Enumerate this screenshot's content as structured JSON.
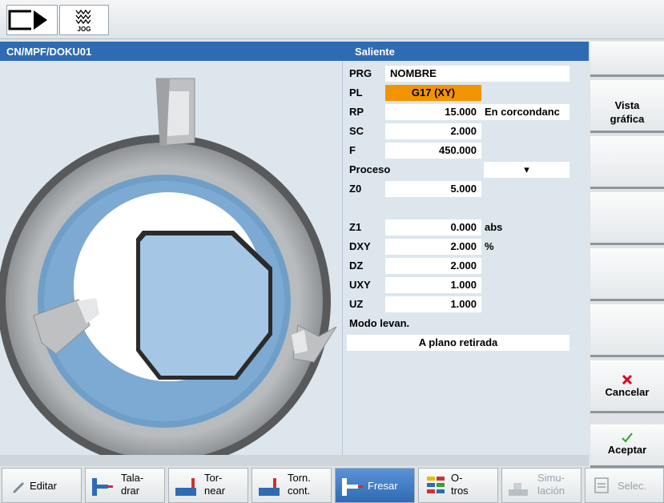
{
  "header": {
    "jog_label": "JOG"
  },
  "title": {
    "path": "CN/MPF/DOKU01",
    "cycle": "Saliente"
  },
  "params": {
    "prg": {
      "label": "PRG",
      "value": "NOMBRE"
    },
    "pl": {
      "label": "PL",
      "value": "G17 (XY)"
    },
    "rp": {
      "label": "RP",
      "value": "15.000",
      "unit": "En corcondanc"
    },
    "sc": {
      "label": "SC",
      "value": "2.000"
    },
    "f": {
      "label": "F",
      "value": "450.000"
    },
    "proceso": {
      "label": "Proceso",
      "value": "▾"
    },
    "z0": {
      "label": "Z0",
      "value": "5.000"
    },
    "z1": {
      "label": "Z1",
      "value": "0.000",
      "unit": "abs"
    },
    "dxy": {
      "label": "DXY",
      "value": "2.000",
      "unit": "%"
    },
    "dz": {
      "label": "DZ",
      "value": "2.000"
    },
    "uxy": {
      "label": "UXY",
      "value": "1.000"
    },
    "uz": {
      "label": "UZ",
      "value": "1.000"
    },
    "modo": {
      "label": "Modo levan.",
      "value": "A plano retirada"
    }
  },
  "softkeys": {
    "vista_line1": "Vista",
    "vista_line2": "gráfica",
    "cancelar": "Cancelar",
    "aceptar": "Aceptar"
  },
  "hbar": {
    "editar": "Editar",
    "taladrar_1": "Tala-",
    "taladrar_2": "drar",
    "tornear_1": "Tor-",
    "tornear_2": "near",
    "torncont_1": "Torn.",
    "torncont_2": "cont.",
    "fresar": "Fresar",
    "otros_1": "O-",
    "otros_2": "tros",
    "simu_1": "Simu-",
    "simu_2": "lación",
    "selec": "Selec."
  },
  "colors": {
    "accent": "#2f6bb2",
    "highlight": "#f29400",
    "cancel": "#e0001b",
    "accept": "#2ea42e"
  }
}
